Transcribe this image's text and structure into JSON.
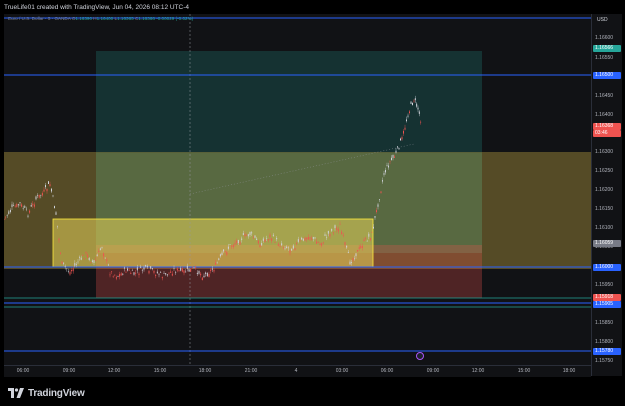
{
  "header": {
    "caption": "TrueLife01 created with TradingView, Jun 04, 2026 08:12 UTC-4"
  },
  "legend": {
    "symbol": "Euro / U.S. Dollar · 5 · OANDA",
    "o_label": "O",
    "o_value": "1.16390",
    "h_label": "H",
    "h_value": "1.16400",
    "l_label": "L",
    "l_value": "1.16365",
    "c_label": "C",
    "c_value": "1.16368",
    "change": "-0.00029 (-0.02%)"
  },
  "price_axis": {
    "currency": "USD",
    "ticks": [
      "1.16600",
      "1.16550",
      "1.16450",
      "1.16400",
      "1.16300",
      "1.16250",
      "1.16200",
      "1.16150",
      "1.16100",
      "1.16050",
      "1.15950",
      "1.15850",
      "1.15800",
      "1.15750"
    ],
    "labels": [
      {
        "value": "1.16566",
        "color": "#26a69a"
      },
      {
        "value": "1.16500",
        "color": "#2962ff"
      },
      {
        "value": "1.16368",
        "color": "#ef5350"
      },
      {
        "value": "03:46",
        "color": "#ef5350"
      },
      {
        "value": "1.16059",
        "color": "#787b86"
      },
      {
        "value": "1.16000",
        "color": "#2962ff"
      },
      {
        "value": "1.15918",
        "color": "#ef5350"
      },
      {
        "value": "1.15905",
        "color": "#2962ff"
      },
      {
        "value": "1.15780",
        "color": "#2962ff"
      }
    ]
  },
  "time_axis": {
    "ticks": [
      "06:00",
      "09:00",
      "12:00",
      "15:00",
      "18:00",
      "21:00",
      "4",
      "03:00",
      "06:00",
      "09:00",
      "12:00",
      "15:00",
      "18:00"
    ]
  },
  "footer": {
    "brand": "TradingView"
  },
  "colors": {
    "background": "#111215",
    "up": "#26a69a",
    "down": "#ef5350",
    "level_line": "#2962ff",
    "yellow_zone": "#e6c34a",
    "profit_zone": "#26a69a",
    "loss_zone": "#ef5350"
  }
}
